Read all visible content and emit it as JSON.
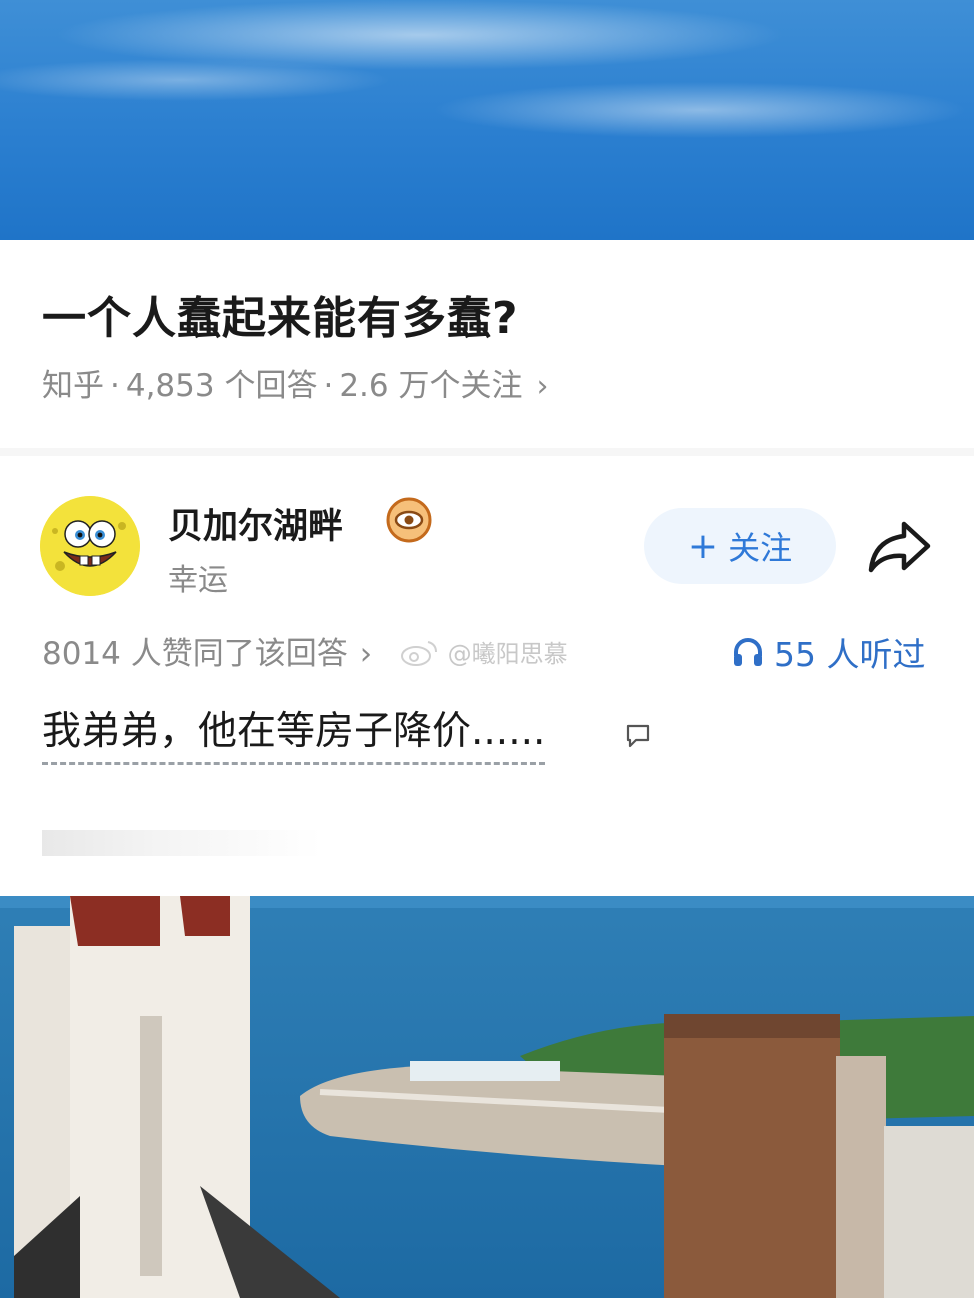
{
  "question": {
    "title": "一个人蠢起来能有多蠢?",
    "source": "知乎",
    "answers": "4,853 个回答",
    "followers": "2.6 万个关注",
    "separator": "·",
    "chevron": "›"
  },
  "author": {
    "name": "贝加尔湖畔",
    "subtitle": "幸运",
    "avatar_icon": "spongebob-avatar",
    "badge_icon": "eye-badge-icon"
  },
  "actions": {
    "follow_plus": "+",
    "follow_label": "关注",
    "share_icon": "share-arrow-icon",
    "accent_color": "#2f79d8"
  },
  "answer": {
    "agree_text": "8014 人赞同了该回答",
    "agree_chevron": "›",
    "watermark": "@曦阳思慕",
    "listen_count": "55 人听过",
    "text": "我弟弟，他在等房子降价......"
  }
}
